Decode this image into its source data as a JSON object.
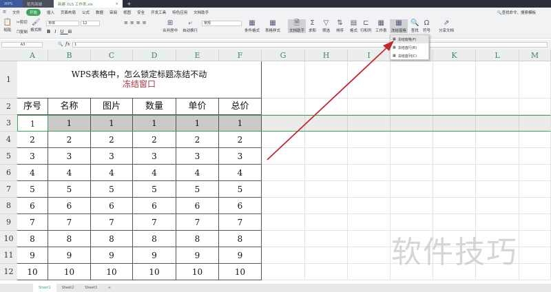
{
  "tabs": [
    {
      "label": "WPS"
    },
    {
      "label": "稻壳商城"
    },
    {
      "label": "新建 XLS 工作表.xls"
    }
  ],
  "menu": [
    "文件",
    "开始",
    "插入",
    "页面布局",
    "公式",
    "数据",
    "审阅",
    "视图",
    "安全",
    "开发工具",
    "特色应用",
    "文档助手"
  ],
  "search_label": "查找命令、搜索模板",
  "toolbar": {
    "paste": "粘贴",
    "cut": "剪切",
    "copy": "复制",
    "format_painter": "格式刷",
    "font": "宋体",
    "size": "12",
    "merge": "合并居中",
    "wrap": "自动换行",
    "numfmt": "常规",
    "cond": "条件格式",
    "table_style": "表格样式",
    "doc_helper": "文档助手",
    "sum": "求和",
    "filter": "筛选",
    "sort": "排序",
    "format": "格式",
    "rowcol": "行和列",
    "sheet": "工作表",
    "freeze": "冻结窗格",
    "find": "查找",
    "symbol": "符号",
    "share": "分享文档"
  },
  "freeze_menu": [
    "冻结窗格(F)",
    "冻结首行(R)",
    "冻结首列(C)"
  ],
  "namebox": "A3",
  "formula": "1",
  "fx": "fx",
  "columns": [
    "A",
    "B",
    "C",
    "D",
    "E",
    "F",
    "G",
    "H",
    "I",
    "J",
    "K",
    "L",
    "M"
  ],
  "rows": [
    "1",
    "2",
    "3",
    "4",
    "5",
    "6",
    "7",
    "8",
    "9",
    "10",
    "11",
    "12"
  ],
  "title_line1": "WPS表格中，怎么锁定标题冻结不动",
  "title_line2": "冻结窗口",
  "headers": [
    "序号",
    "名称",
    "图片",
    "数量",
    "单价",
    "总价"
  ],
  "values": [
    "1",
    "2",
    "3",
    "4",
    "5",
    "6",
    "7",
    "8",
    "9",
    "10"
  ],
  "sheets": [
    "Sheet1",
    "Sheet2",
    "Sheet3"
  ],
  "watermark": "软件技巧",
  "colors": {
    "accent": "#3aa45a",
    "title2": "#b03040",
    "arrow": "#c0282d"
  }
}
